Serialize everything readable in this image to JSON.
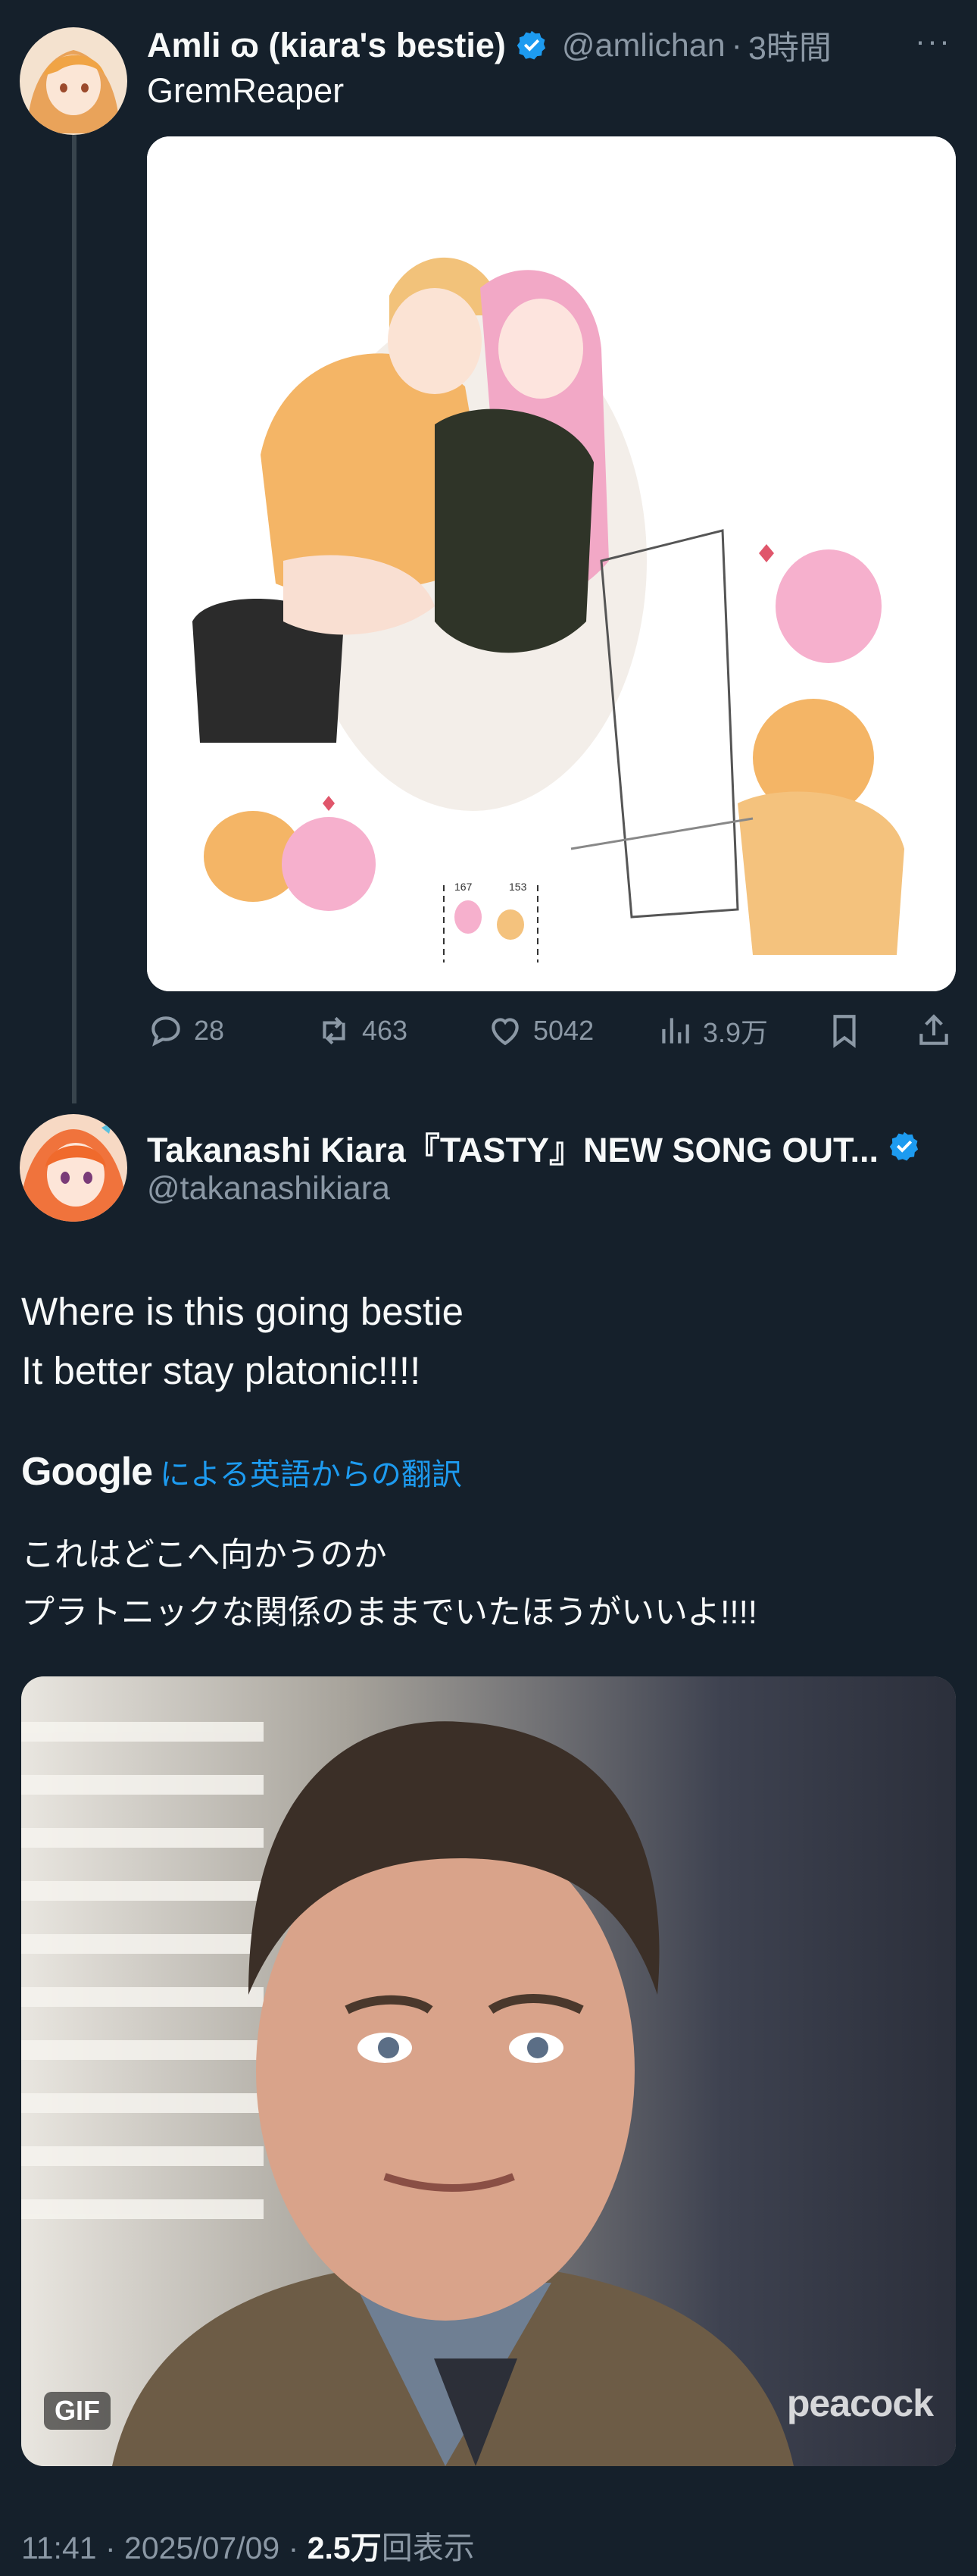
{
  "tweet1": {
    "display_name": "Amli ɷ (kiara's bestie)",
    "handle": "@amlichan",
    "separator": "·",
    "time": "3時間",
    "more": "···",
    "subline": "GremReaper",
    "media_labels": [
      "167",
      "153"
    ],
    "actions": {
      "reply_count": "28",
      "retweet_count": "463",
      "like_count": "5042",
      "views_count": "3.9万"
    }
  },
  "tweet2": {
    "display_name": "Takanashi Kiara『TASTY』NEW SONG OUT...",
    "handle": "@takanashikiara",
    "text_lines": [
      "Where is this going bestie",
      "It better stay platonic!!!!"
    ],
    "translation": {
      "provider": "Google",
      "label": "による英語からの翻訳",
      "lines": [
        "これはどこへ向かうのか",
        "プラトニックな関係のままでいたほうがいいよ!!!!"
      ]
    },
    "media": {
      "badge": "GIF",
      "watermark": "peacock"
    },
    "meta": {
      "time": "11:41",
      "sep1": "·",
      "date": "2025/07/09",
      "sep2": "·",
      "views": "2.5万",
      "views_label": "回表示"
    }
  },
  "colors": {
    "background": "#15202b",
    "accent": "#1d9bf0",
    "muted": "#8b98a5",
    "text": "#f7f9f9"
  },
  "icons": [
    "verified-badge-icon",
    "more-icon",
    "reply-icon",
    "retweet-icon",
    "like-icon",
    "views-icon",
    "bookmark-icon",
    "share-icon"
  ]
}
